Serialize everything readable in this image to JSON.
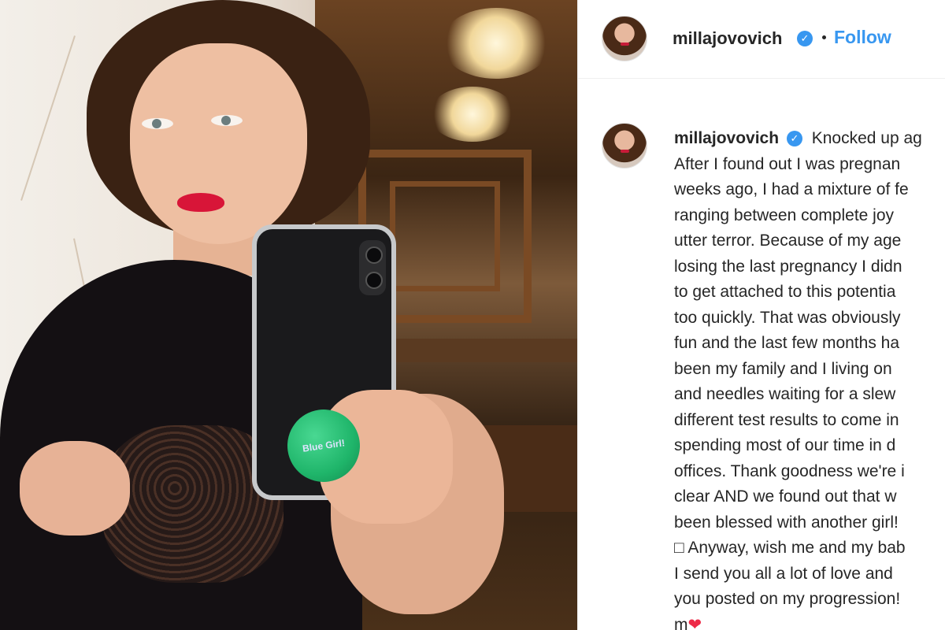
{
  "post": {
    "photo_alt": "",
    "popsocket_text": "Blue Girl!"
  },
  "header": {
    "username": "millajovovich",
    "verified_icon": "verified-badge-icon",
    "separator": "•",
    "follow_label": "Follow",
    "accent_color": "#3897f0"
  },
  "caption": {
    "username": "millajovovich",
    "first_line_text": "Knocked up ag",
    "lines": [
      "After I found out I was pregnan",
      "weeks ago, I had a mixture of fe",
      "ranging between complete joy",
      "utter terror. Because of my age",
      "losing the last pregnancy I didn",
      "to get attached to this potentia",
      "too quickly. That was obviously",
      "fun and the last few months ha",
      "been my family and I living on",
      "and needles waiting for a slew",
      "different test results to come in",
      "spending most of our time in d",
      "offices. Thank goodness we're i",
      "clear AND we found out that w",
      "been blessed with another girl!",
      "□ Anyway, wish me and my bab",
      "I send you all a lot of love and",
      "you posted on my progression!"
    ],
    "last_line_text": "m",
    "last_line_emoji": "❤"
  }
}
